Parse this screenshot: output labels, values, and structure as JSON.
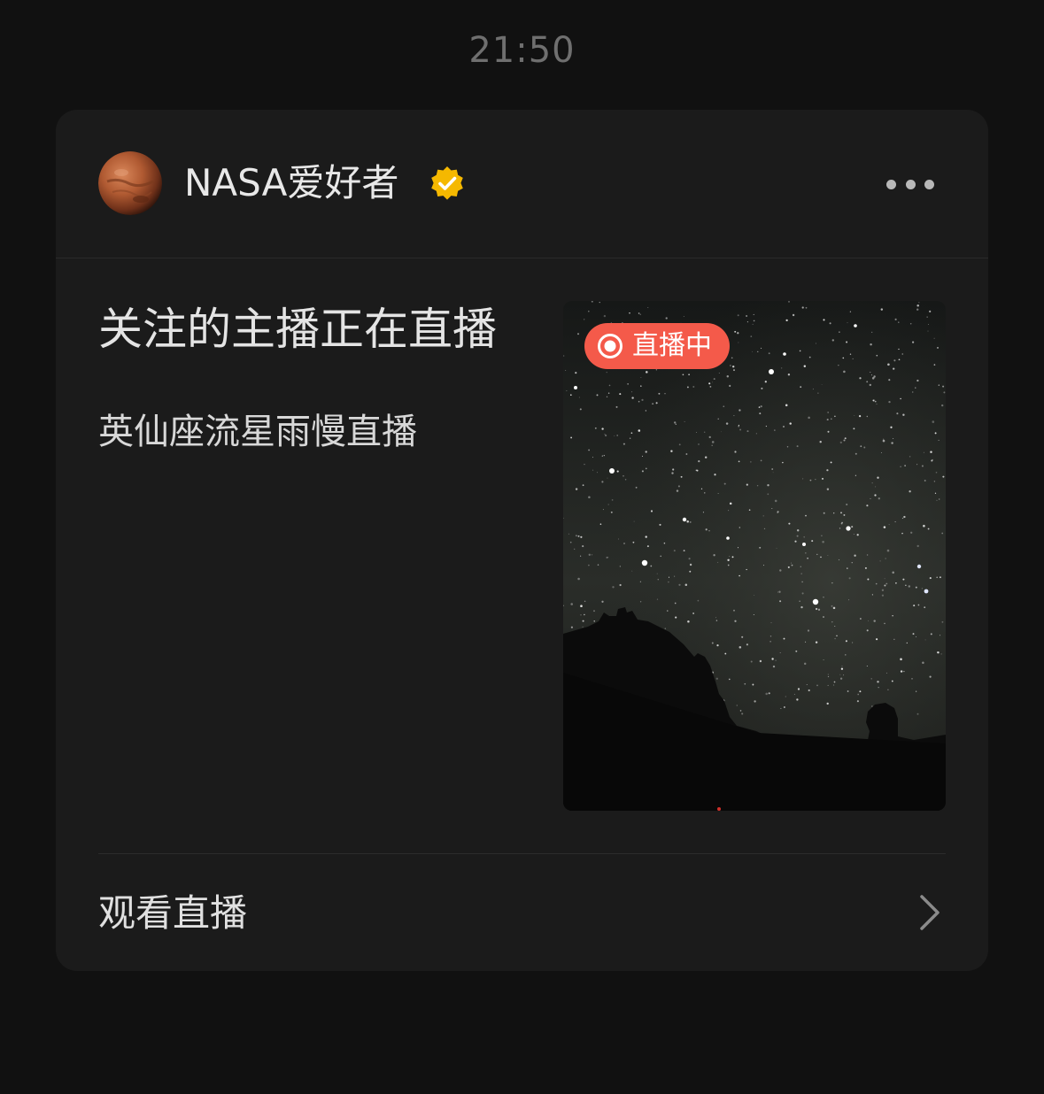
{
  "timestamp": "21:50",
  "card": {
    "account_name": "NASA爱好者",
    "avatar_icon": "mars-avatar",
    "verified_icon": "verified-badge-icon",
    "more_icon": "more-dots-icon",
    "title": "关注的主播正在直播",
    "subtitle": "英仙座流星雨慢直播",
    "thumbnail": {
      "badge_label": "直播中",
      "badge_color": "#f45a4a"
    },
    "action_label": "观看直播",
    "action_icon": "chevron-right-icon"
  },
  "colors": {
    "background": "#111111",
    "card": "#1b1b1b",
    "verified": "#f5b800",
    "live": "#f45a4a"
  }
}
